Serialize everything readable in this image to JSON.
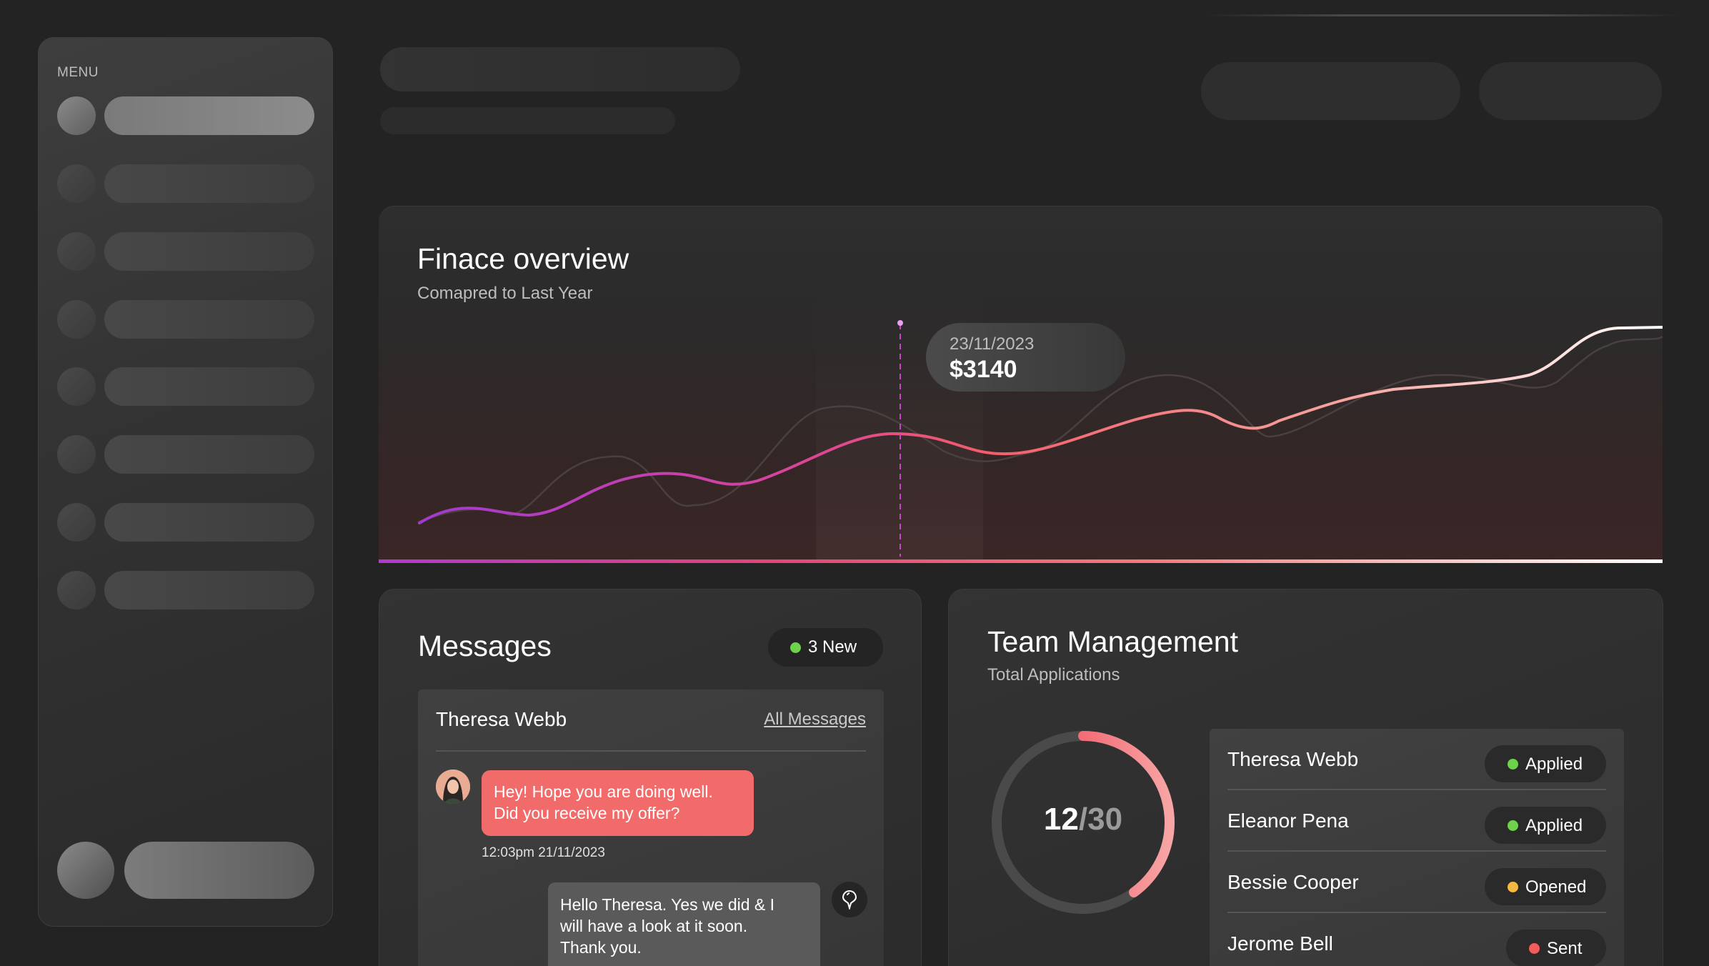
{
  "sidebar": {
    "menu_label": "MENU"
  },
  "finance": {
    "title": "Finace overview",
    "subtitle": "Comapred to Last Year",
    "tooltip": {
      "date": "23/11/2023",
      "value": "$3140"
    }
  },
  "messages": {
    "title": "Messages",
    "new_badge": "3 New",
    "new_badge_color": "#6dd34a",
    "contact_name": "Theresa Webb",
    "all_messages_link": "All Messages",
    "incoming": {
      "line1": "Hey! Hope you are doing well.",
      "line2": "Did you receive my offer?",
      "time": "12:03pm 21/11/2023"
    },
    "outgoing": {
      "line1": "Hello Theresa. Yes we did & I",
      "line2": "will have a look at it soon.",
      "line3": "Thank you."
    },
    "icons": {
      "avatar": "user-avatar",
      "pin": "pin-icon"
    }
  },
  "team": {
    "title": "Team Management",
    "subtitle": "Total Applications",
    "count_current": "12",
    "count_separator": "/",
    "count_total": "30",
    "progress_fraction": 0.4,
    "applicants": [
      {
        "name": "Theresa Webb",
        "status": "Applied",
        "status_color": "#6dd34a"
      },
      {
        "name": "Eleanor Pena",
        "status": "Applied",
        "status_color": "#6dd34a"
      },
      {
        "name": "Bessie Cooper",
        "status": "Opened",
        "status_color": "#f5b942"
      },
      {
        "name": "Jerome Bell",
        "status": "Sent",
        "status_color": "#f25c5c"
      }
    ]
  },
  "colors": {
    "accent_magenta": "#b03ad0",
    "accent_coral": "#f26b6b",
    "background": "#232323"
  }
}
